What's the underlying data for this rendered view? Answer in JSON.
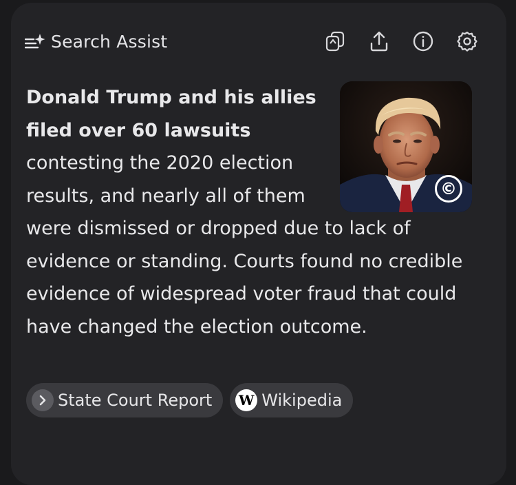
{
  "header": {
    "title": "Search Assist",
    "brand_icon": "sparkle-list-icon",
    "actions": [
      {
        "name": "copy-icon"
      },
      {
        "name": "share-icon"
      },
      {
        "name": "info-icon"
      },
      {
        "name": "settings-icon"
      }
    ]
  },
  "answer": {
    "bold_text": "Donald Trump and his allies filed over 60 lawsuits",
    "body_text": " contesting the 2020 election results, and nearly all of them were dismissed or dropped due to lack of evidence or standing. Courts found no credible evidence of widespread voter fraud that could have changed the election outcome."
  },
  "image": {
    "copyright_mark": "©"
  },
  "sources": [
    {
      "label": "State Court Report",
      "icon": "chevron-right-icon"
    },
    {
      "label": "Wikipedia",
      "icon": "wikipedia-icon",
      "icon_text": "W"
    }
  ]
}
